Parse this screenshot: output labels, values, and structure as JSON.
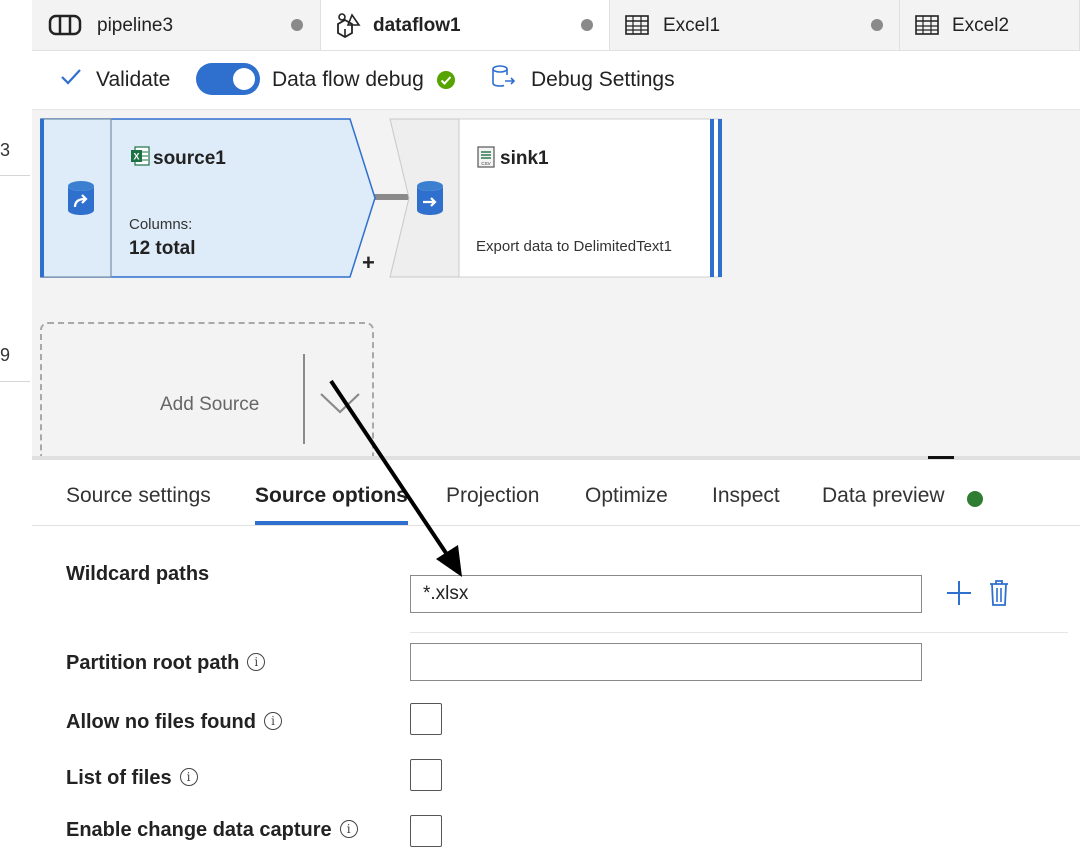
{
  "left_strip": {
    "num_top": "3",
    "num_bottom": "9"
  },
  "tabs": [
    {
      "label": "pipeline3",
      "icon": "pipeline-icon",
      "unsaved": true
    },
    {
      "label": "dataflow1",
      "icon": "dataflow-icon",
      "unsaved": true,
      "active": true
    },
    {
      "label": "Excel1",
      "icon": "table-icon",
      "unsaved": true
    },
    {
      "label": "Excel2",
      "icon": "table-icon",
      "unsaved": false
    }
  ],
  "toolbar": {
    "validate_label": "Validate",
    "debug_label": "Data flow debug",
    "debug_on": true,
    "debug_settings_label": "Debug Settings"
  },
  "canvas": {
    "source": {
      "title": "source1",
      "columns_label": "Columns:",
      "columns_value": "12 total",
      "plus": "+"
    },
    "sink": {
      "title": "sink1",
      "description": "Export data to DelimitedText1"
    },
    "add_source_label": "Add Source"
  },
  "panel": {
    "tabs": [
      "Source settings",
      "Source options",
      "Projection",
      "Optimize",
      "Inspect",
      "Data preview"
    ],
    "active_tab": "Source options",
    "fields": {
      "wildcard_label": "Wildcard paths",
      "wildcard_value": "*.xlsx",
      "partition_label": "Partition root path",
      "partition_value": "",
      "allow_no_files_label": "Allow no files found",
      "list_of_files_label": "List of files",
      "enable_change_label": "Enable change data capture"
    },
    "info_glyph": "i"
  },
  "colors": {
    "accent": "#2f6fce",
    "success": "#57a300",
    "preview_dot": "#2e7d32",
    "canvas_bg": "#f3f3f3",
    "source_node_bg": "#deecf9"
  }
}
